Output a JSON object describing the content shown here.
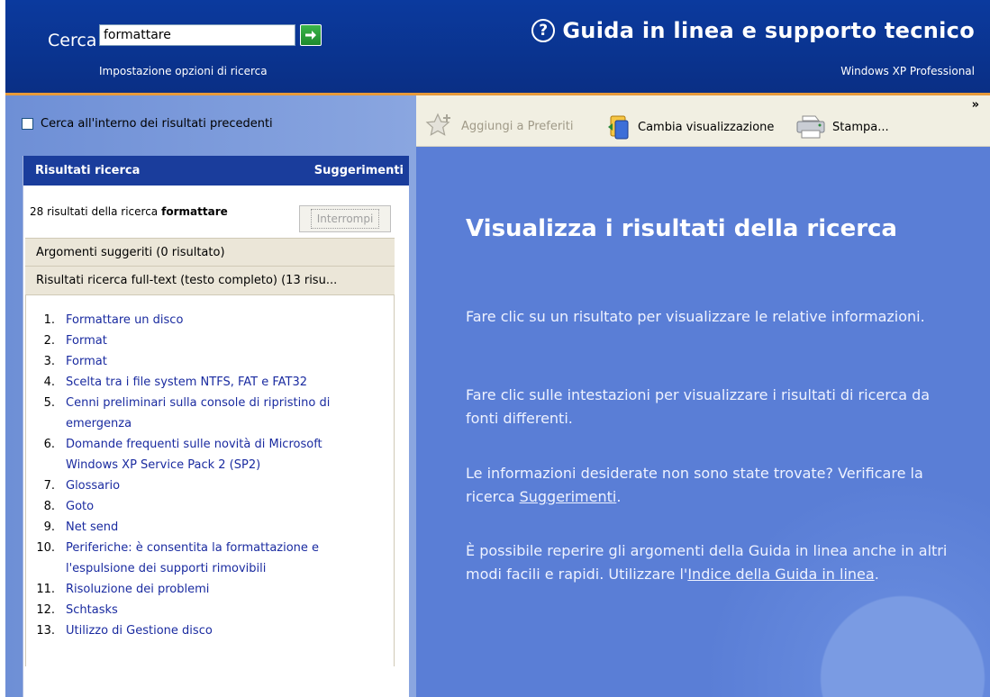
{
  "header": {
    "search_label": "Cerca",
    "search_value": "formattare",
    "search_options": "Impostazione opzioni di ricerca",
    "title": "Guida in linea e supporto tecnico",
    "product": "Windows XP Professional"
  },
  "left": {
    "prev_results_label": "Cerca all'interno dei risultati precedenti",
    "tab_results": "Risultati ricerca",
    "tab_suggestions": "Suggerimenti",
    "count_text": "28 risultati della ricerca",
    "count_term": "formattare",
    "stop_label": "Interrompi",
    "section_suggested": "Argomenti suggeriti (0 risultato)",
    "section_fulltext": "Risultati ricerca full-text (testo completo) (13 risu...",
    "results": [
      {
        "num": "1.",
        "title": "Formattare un disco"
      },
      {
        "num": "2.",
        "title": "Format"
      },
      {
        "num": "3.",
        "title": "Format"
      },
      {
        "num": "4.",
        "title": "Scelta tra i file system NTFS, FAT e FAT32"
      },
      {
        "num": "5.",
        "title": "Cenni preliminari sulla console di ripristino di emergenza"
      },
      {
        "num": "6.",
        "title": "Domande frequenti sulle novità di Microsoft Windows XP Service Pack 2 (SP2)"
      },
      {
        "num": "7.",
        "title": "Glossario"
      },
      {
        "num": "8.",
        "title": "Goto"
      },
      {
        "num": "9.",
        "title": "Net send"
      },
      {
        "num": "10.",
        "title": "Periferiche: è consentita la formattazione e l'espulsione dei supporti rimovibili"
      },
      {
        "num": "11.",
        "title": "Risoluzione dei problemi"
      },
      {
        "num": "12.",
        "title": "Schtasks"
      },
      {
        "num": "13.",
        "title": "Utilizzo di Gestione disco"
      }
    ]
  },
  "toolbar": {
    "add_favorites": "Aggiungi a Preferiti",
    "change_view": "Cambia visualizzazione",
    "print": "Stampa...",
    "more": "»"
  },
  "content": {
    "title": "Visualizza i risultati della ricerca",
    "p1": "Fare clic su un risultato per visualizzare le relative informazioni.",
    "p2": "Fare clic sulle intestazioni per visualizzare i risultati di ricerca da fonti differenti.",
    "p3_text": "Le informazioni desiderate non sono state trovate? Verificare la ricerca ",
    "p3_link": "Suggerimenti",
    "p3_end": ".",
    "p4_text": "È possibile reperire gli argomenti della Guida in linea anche in altri modi facili e rapidi. Utilizzare l'",
    "p4_link": "Indice della Guida in linea",
    "p4_end": "."
  },
  "colors": {
    "header_blue": "#0a2f85",
    "accent_orange": "#e79a3a",
    "panel_blue": "#7b99d9",
    "content_blue": "#5a7ed6",
    "link_blue": "#1a2ba0"
  }
}
